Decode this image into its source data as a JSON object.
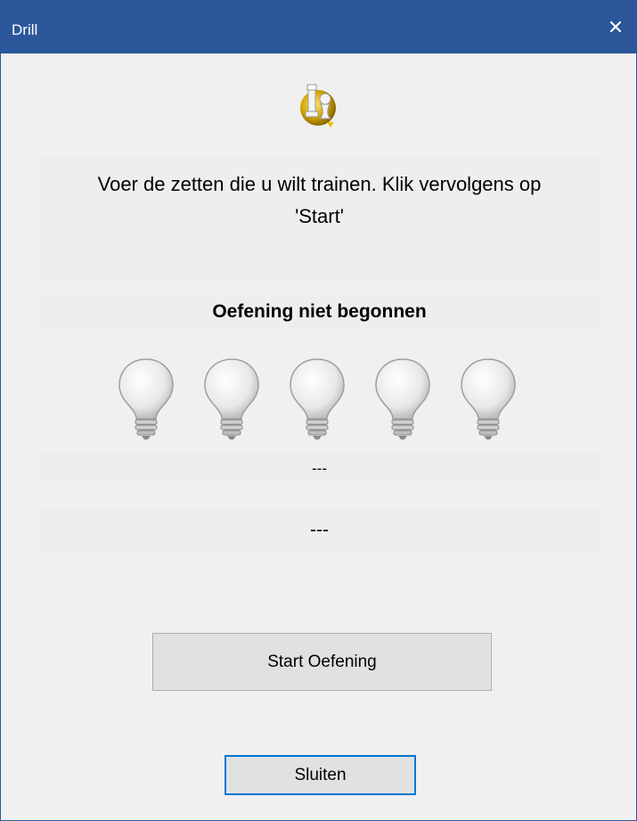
{
  "window": {
    "title": "Drill",
    "close_glyph": "×",
    "colors": {
      "titlebar": "#2b579a",
      "client_background": "#f0f0f0",
      "focus_border": "#0078d7"
    }
  },
  "app_icon": "chess-drill-icon",
  "instruction": {
    "line1": "Voer de zetten die u wilt trainen. Klik vervolgens op",
    "line2": "'Start'"
  },
  "status": {
    "text": "Oefening niet begonnen"
  },
  "hints": {
    "icon": "lightbulb-icon",
    "count": 5,
    "lit": 0
  },
  "results": {
    "line1": "---",
    "line2": "---"
  },
  "buttons": {
    "start_label": "Start Oefening",
    "close_label": "Sluiten"
  }
}
